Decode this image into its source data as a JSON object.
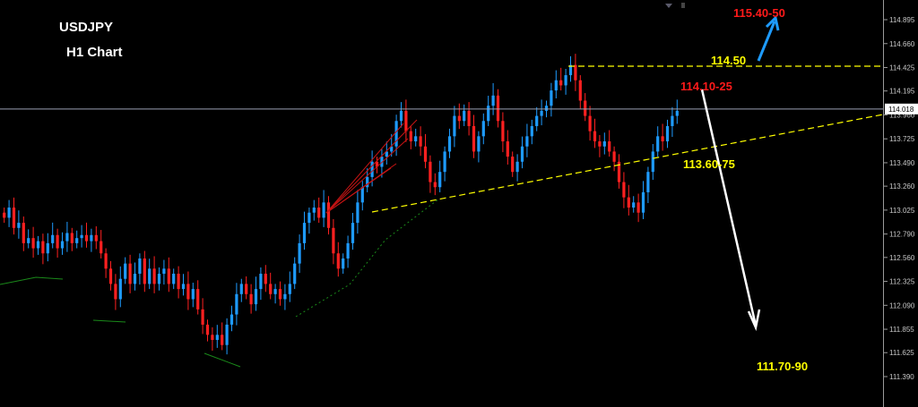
{
  "chart_data": {
    "type": "candlestick",
    "title": "USDJPY",
    "subtitle": "H1 Chart",
    "ylim": [
      111.39,
      115.1
    ],
    "y_ticks": [
      {
        "value": 114.895,
        "label": "114.895"
      },
      {
        "value": 114.66,
        "label": "114.660"
      },
      {
        "value": 114.425,
        "label": "114.425"
      },
      {
        "value": 114.195,
        "label": "114.195"
      },
      {
        "value": 113.96,
        "label": "113.960"
      },
      {
        "value": 113.725,
        "label": "113.725"
      },
      {
        "value": 113.49,
        "label": "113.490"
      },
      {
        "value": 113.26,
        "label": "113.260"
      },
      {
        "value": 113.025,
        "label": "113.025"
      },
      {
        "value": 112.79,
        "label": "112.790"
      },
      {
        "value": 112.56,
        "label": "112.560"
      },
      {
        "value": 112.325,
        "label": "112.325"
      },
      {
        "value": 112.09,
        "label": "112.090"
      },
      {
        "value": 111.855,
        "label": "111.855"
      },
      {
        "value": 111.625,
        "label": "111.625"
      },
      {
        "value": 111.39,
        "label": "111.390"
      }
    ],
    "current_price": {
      "value": 114.018,
      "label": "114.018"
    },
    "colors": {
      "up": "#1e9bff",
      "down": "#ff2020",
      "annotation_yellow": "#ffff00",
      "annotation_red": "#ff1a1a",
      "arrow_up": "#1e9bff",
      "arrow_down": "#ffffff",
      "price_line": "#9aa0b4"
    },
    "closes": [
      112.95,
      113.05,
      112.85,
      112.9,
      112.7,
      112.75,
      112.65,
      112.72,
      112.6,
      112.7,
      112.78,
      112.65,
      112.72,
      112.8,
      112.7,
      112.75,
      112.78,
      112.72,
      112.78,
      112.72,
      112.6,
      112.45,
      112.3,
      112.15,
      112.35,
      112.5,
      112.3,
      112.4,
      112.55,
      112.3,
      112.45,
      112.3,
      112.4,
      112.45,
      112.3,
      112.4,
      112.25,
      112.3,
      112.15,
      112.25,
      112.05,
      111.9,
      111.8,
      111.75,
      111.8,
      111.7,
      111.9,
      112.0,
      112.2,
      112.3,
      112.2,
      112.1,
      112.25,
      112.4,
      112.3,
      112.2,
      112.25,
      112.15,
      112.2,
      112.3,
      112.5,
      112.7,
      112.9,
      113.0,
      113.05,
      112.95,
      113.1,
      112.85,
      112.6,
      112.45,
      112.55,
      112.7,
      112.9,
      113.1,
      113.25,
      113.35,
      113.5,
      113.45,
      113.55,
      113.6,
      113.65,
      113.9,
      114.0,
      113.8,
      113.7,
      113.75,
      113.65,
      113.5,
      113.3,
      113.25,
      113.4,
      113.6,
      113.75,
      113.95,
      113.9,
      114.0,
      113.85,
      113.6,
      113.75,
      113.9,
      114.05,
      114.15,
      113.9,
      113.7,
      113.55,
      113.4,
      113.5,
      113.65,
      113.75,
      113.85,
      113.95,
      114.0,
      114.05,
      114.2,
      114.3,
      114.25,
      114.35,
      114.45,
      114.3,
      114.1,
      113.95,
      113.8,
      113.7,
      113.65,
      113.7,
      113.6,
      113.5,
      113.3,
      113.15,
      113.05,
      113.1,
      113.0,
      113.2,
      113.4,
      113.6,
      113.75,
      113.7,
      113.85,
      113.95,
      114.0
    ]
  },
  "title_text": "USDJPY",
  "subtitle_text": "H1 Chart",
  "annotations": {
    "target_high": "115.40-50",
    "level_1": "114.50",
    "level_2": "114.10-25",
    "level_3": "113.60-75",
    "target_low": "111.70-90"
  }
}
